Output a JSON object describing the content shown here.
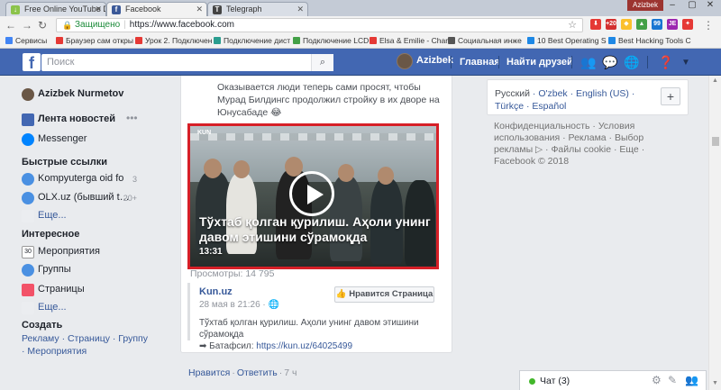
{
  "browser": {
    "tabs": [
      {
        "label": "Free Online YouTube Do",
        "icon": "download-icon",
        "color": "#8bc34a"
      },
      {
        "label": "Facebook",
        "icon": "facebook-icon",
        "color": "#3b5998"
      },
      {
        "label": "Telegraph",
        "icon": "telegraph-icon",
        "color": "#444444"
      }
    ],
    "profile_name": "Azizbek",
    "secure_label": "Защищено",
    "url": "https://www.facebook.com",
    "bookmarks": [
      {
        "label": "Сервисы",
        "color": "#4285f4"
      },
      {
        "label": "Браузер сам откры",
        "color": "#e53935"
      },
      {
        "label": "Урок 2. Подключен",
        "color": "#e53935"
      },
      {
        "label": "Подключение дист",
        "color": "#2a9d8f"
      },
      {
        "label": "Подключение LCD",
        "color": "#43a047"
      },
      {
        "label": "Elsa & Emilie - Char",
        "color": "#e53935"
      },
      {
        "label": "Социальная инже",
        "color": "#555555"
      },
      {
        "label": "10 Best Operating S",
        "color": "#1e88e5"
      },
      {
        "label": "Best Hacking Tools C",
        "color": "#1e88e5"
      }
    ]
  },
  "fb": {
    "logo": "f",
    "search_placeholder": "Поиск",
    "user": "Azizbek",
    "nav_home": "Главная",
    "nav_find_friends": "Найти друзей"
  },
  "sidebar": {
    "profile": "Azizbek Nurmetov",
    "news_feed": "Лента новостей",
    "messenger": "Messenger",
    "shortcuts_heading": "Быстрые ссылки",
    "shortcuts": [
      {
        "label": "Kompyuterga oid fo",
        "count": "3"
      },
      {
        "label": "OLX.uz (бывший t…",
        "count": "20+"
      }
    ],
    "more": "Еще...",
    "explore_heading": "Интересное",
    "explore": [
      "Мероприятия",
      "Группы",
      "Страницы"
    ],
    "create_heading": "Создать",
    "create_links": "Рекламу · Страницу · Группу · Мероприятия"
  },
  "post": {
    "text": "Оказывается люди теперь сами просят, чтобы Мурад Билдингс продолжил стройку в их дворе на Юнусабаде 😂",
    "video_brand": "KUN",
    "video_title": "Тўхтаб қолган қурилиш. Аҳоли унинг давом этишини сўрамоқда",
    "video_duration": "13:31",
    "views": "Просмотры: 14 795",
    "shared_page": "Kun.uz",
    "shared_date": "28 мая в 21:26 · 🌐",
    "like_page_button": "👍 Нравится Страница",
    "shared_desc": "Тўхтаб қолган қурилиш. Аҳоли унинг давом этишини сўрамоқда",
    "shared_link_prefix": "➡ Батафсил: ",
    "shared_link": "https://kun.uz/64025499",
    "like": "Нравится",
    "reply": "Ответить",
    "time": "7 ч"
  },
  "right": {
    "language_current": "Русский",
    "languages": "O'zbek · English (US) · Türkçe · Español",
    "footer": "Конфиденциальность · Условия использования · Реклама · Выбор рекламы ▷ · Файлы cookie · Еще ·",
    "copyright": "Facebook © 2018",
    "chat_label": "Чат (3)"
  }
}
